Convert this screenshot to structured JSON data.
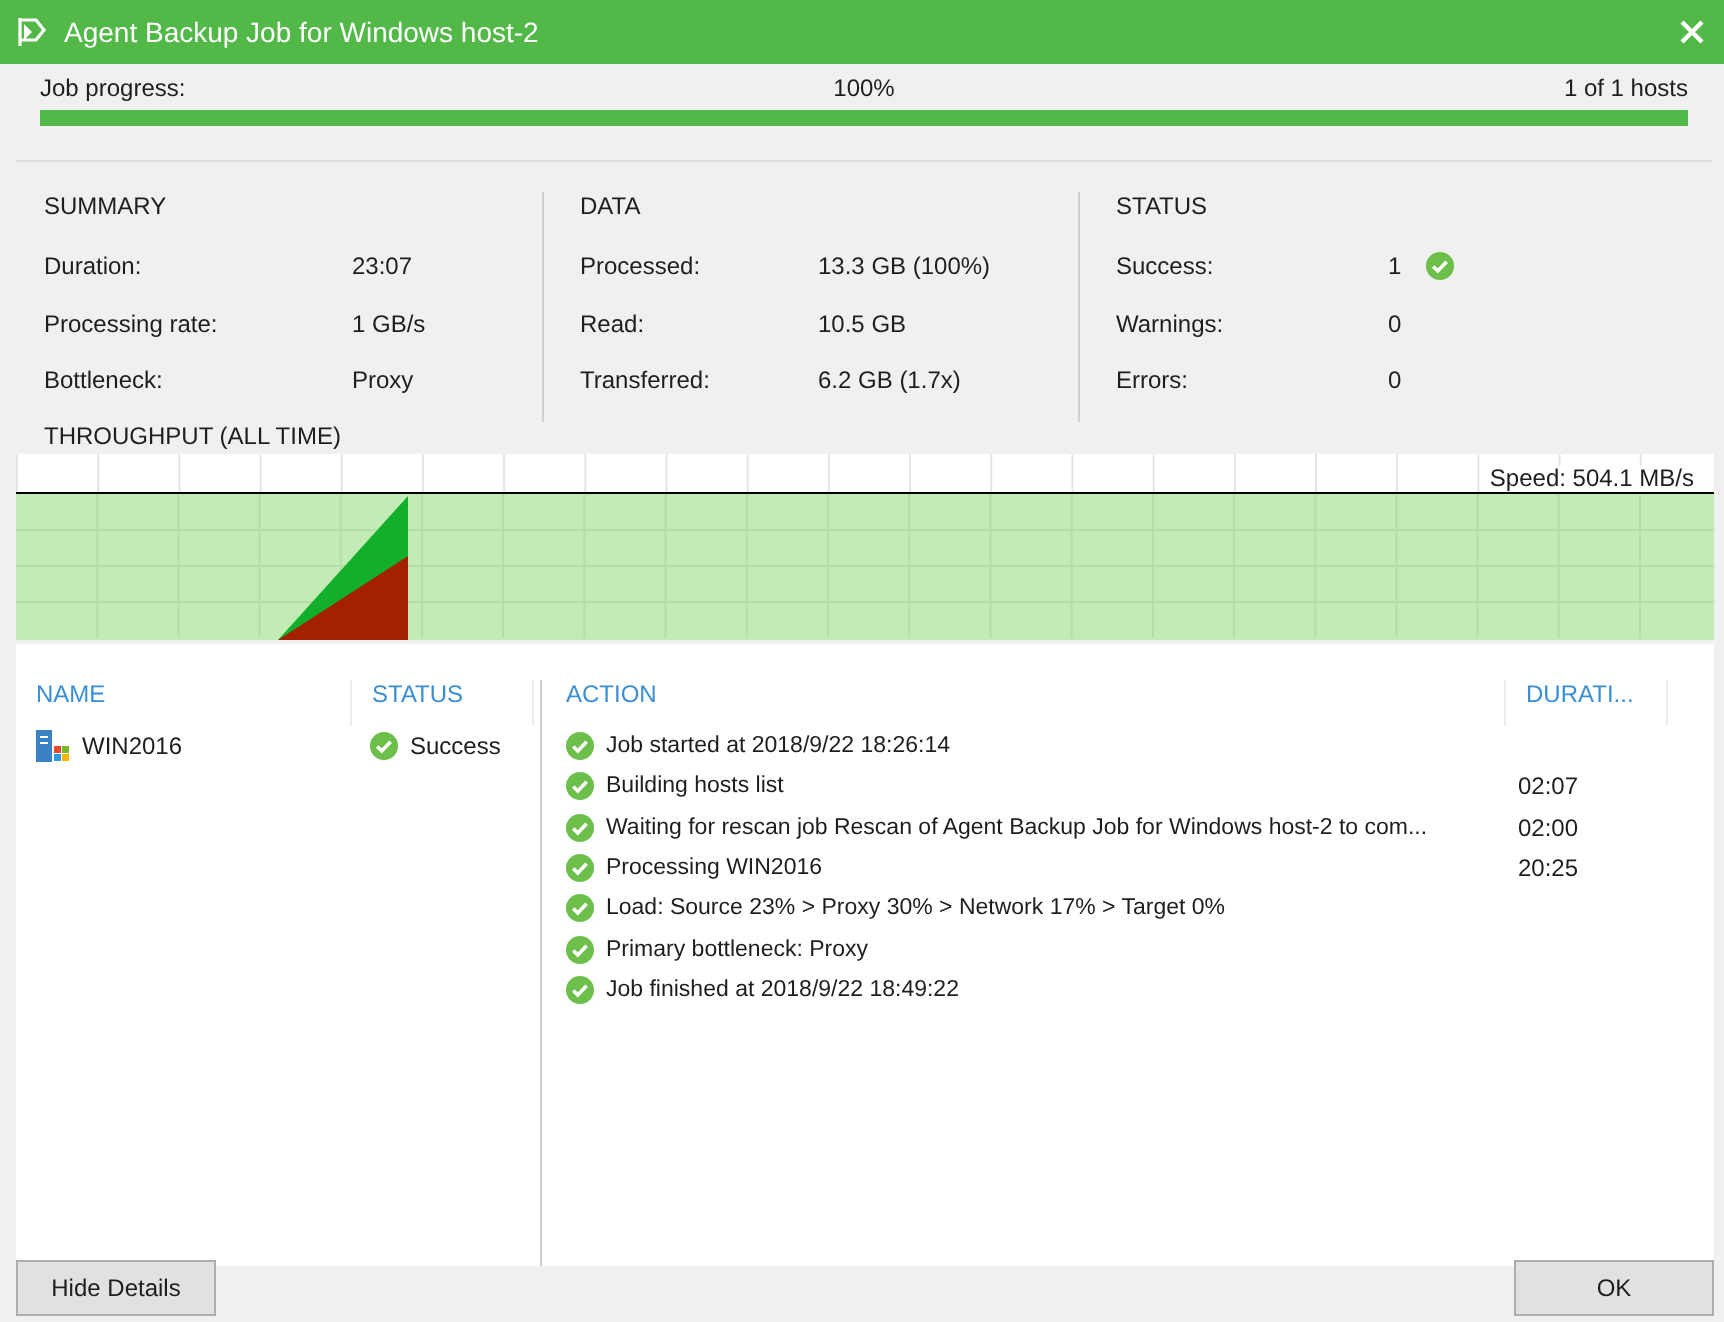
{
  "window": {
    "title": "Agent Backup Job for Windows host-2"
  },
  "progress": {
    "label": "Job progress:",
    "percent": "100%",
    "hosts": "1 of 1 hosts",
    "level": 1
  },
  "summary": {
    "title": "SUMMARY",
    "rows": [
      {
        "label": "Duration:",
        "value": "23:07"
      },
      {
        "label": "Processing rate:",
        "value": "1 GB/s"
      },
      {
        "label": "Bottleneck:",
        "value": "Proxy"
      }
    ]
  },
  "data": {
    "title": "DATA",
    "rows": [
      {
        "label": "Processed:",
        "value": "13.3 GB (100%)"
      },
      {
        "label": "Read:",
        "value": "10.5 GB"
      },
      {
        "label": "Transferred:",
        "value": "6.2 GB (1.7x)"
      }
    ]
  },
  "status": {
    "title": "STATUS",
    "rows": [
      {
        "label": "Success:",
        "value": "1",
        "kind": "success"
      },
      {
        "label": "Warnings:",
        "value": "0"
      },
      {
        "label": "Errors:",
        "value": "0"
      }
    ]
  },
  "throughput": {
    "title": "THROUGHPUT (ALL TIME)",
    "speed": "Speed: 504.1 MB/s"
  },
  "hosts": {
    "columns": [
      "NAME",
      "STATUS"
    ],
    "rows": [
      {
        "name": "WIN2016",
        "kind": "success",
        "status_text": "Success"
      }
    ]
  },
  "actions": {
    "columns": [
      "ACTION",
      "DURATI..."
    ],
    "rows": [
      {
        "kind": "success",
        "text": "Job started at 2018/9/22 18:26:14"
      },
      {
        "kind": "success",
        "text": "Building hosts list",
        "duration": "02:07"
      },
      {
        "kind": "success",
        "text": "Waiting for rescan job Rescan of Agent Backup Job for Windows host-2 to com...",
        "duration": "02:00"
      },
      {
        "kind": "success",
        "text": "Processing WIN2016",
        "duration": "20:25"
      },
      {
        "kind": "success",
        "text": "Load: Source 23% > Proxy 30% > Network 17% > Target 0%"
      },
      {
        "kind": "success",
        "text": "Primary bottleneck: Proxy"
      },
      {
        "kind": "success",
        "text": "Job finished at 2018/9/22 18:49:22"
      }
    ]
  },
  "buttons": {
    "left": "Hide Details",
    "right": "OK"
  }
}
